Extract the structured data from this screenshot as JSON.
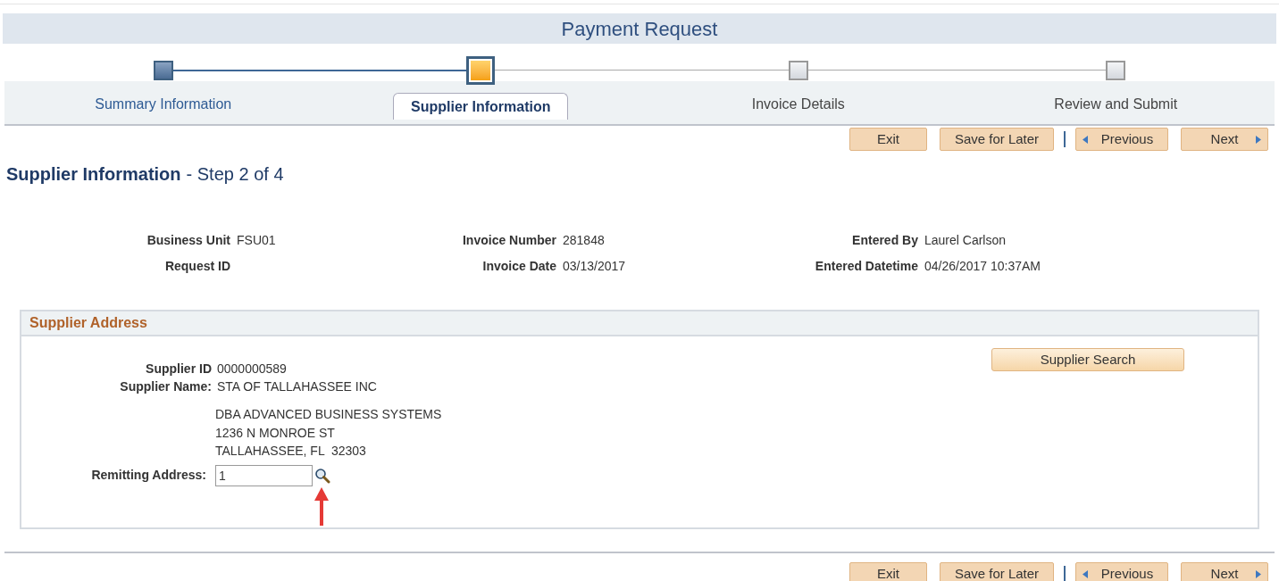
{
  "page_title": "Payment Request",
  "steps": [
    {
      "label": "Summary Information",
      "completed": true,
      "selected": false
    },
    {
      "label": "Supplier Information",
      "completed": false,
      "selected": true
    },
    {
      "label": "Invoice Details",
      "completed": false,
      "selected": false
    },
    {
      "label": "Review and Submit",
      "completed": false,
      "selected": false
    }
  ],
  "top_buttons": [
    {
      "label": "Exit",
      "kind": "plain"
    },
    {
      "label": "Save for Later",
      "kind": "plain"
    },
    {
      "label": "Previous",
      "kind": "previous"
    },
    {
      "label": "Next",
      "kind": "next"
    }
  ],
  "heading": {
    "title": "Supplier Information",
    "subtitle": "- Step 2 of 4"
  },
  "header_fields": [
    [
      {
        "label": "Business Unit",
        "value": "FSU01"
      },
      {
        "label": "Request ID"
      }
    ],
    [
      {
        "label": "Invoice Number",
        "value": "281848"
      },
      {
        "label": "Invoice Date",
        "value": "03/13/2017"
      }
    ],
    [
      {
        "label": "Entered By",
        "value": "Laurel Carlson"
      },
      {
        "label": "Entered Datetime",
        "value": "04/26/2017 10:37AM"
      }
    ]
  ],
  "supplier_address": {
    "title": "Supplier Address",
    "supplier_id": {
      "label": "Supplier ID",
      "value": "0000000589"
    },
    "supplier_name": {
      "label": "Supplier Name:",
      "value": "STA OF TALLAHASSEE INC"
    },
    "address_lines": [
      "DBA ADVANCED BUSINESS SYSTEMS",
      "1236 N MONROE ST",
      "TALLAHASSEE, FL  32303"
    ],
    "remitting_address": {
      "label": "Remitting Address:",
      "value": "1"
    },
    "search_button": "Supplier Search"
  },
  "bottom_buttons": [
    {
      "label": "Exit",
      "kind": "plain"
    },
    {
      "label": "Save for Later",
      "kind": "plain"
    },
    {
      "label": "Previous",
      "kind": "previous"
    },
    {
      "label": "Next",
      "kind": "next"
    }
  ]
}
